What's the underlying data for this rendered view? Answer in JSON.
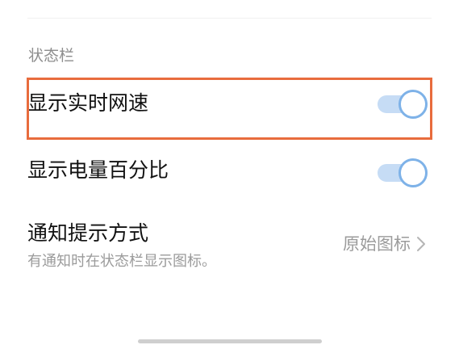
{
  "section": {
    "title": "状态栏"
  },
  "rows": [
    {
      "label": "显示实时网速",
      "toggle_on": true
    },
    {
      "label": "显示电量百分比",
      "toggle_on": true
    },
    {
      "label": "通知提示方式",
      "subtitle": "有通知时在状态栏显示图标。",
      "value": "原始图标",
      "icon": "chevron-right-icon"
    }
  ],
  "colors": {
    "highlight_border": "#e86c3d",
    "toggle_track": "#c6dcf5",
    "toggle_knob_border": "#7eb2e8",
    "primary_text": "#111111",
    "secondary_text": "#9b9b9b"
  }
}
